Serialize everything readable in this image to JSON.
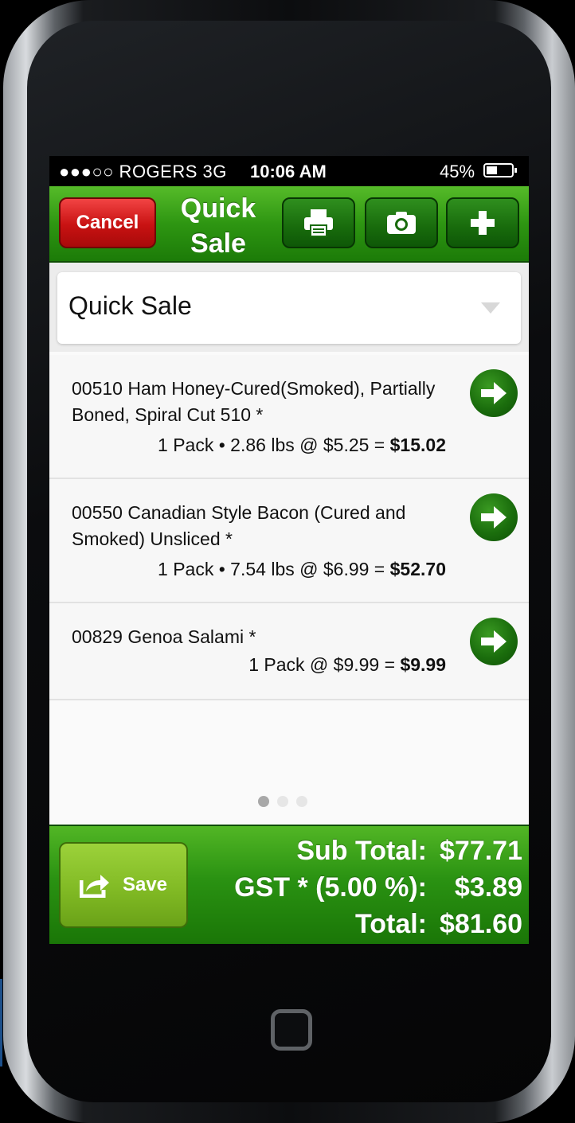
{
  "status_bar": {
    "carrier": "●●●○○ ROGERS  3G",
    "time": "10:06 AM",
    "battery": "45%",
    "battery_level": 0.45
  },
  "nav": {
    "cancel_label": "Cancel",
    "title_line1": "Quick",
    "title_line2": "Sale",
    "print_icon": "printer-icon",
    "camera_icon": "camera-icon",
    "add_icon": "plus-icon"
  },
  "selector": {
    "value": "Quick Sale"
  },
  "items": [
    {
      "line1": "00510 Ham Honey-Cured(Smoked), Partially",
      "line2": "Boned, Spiral Cut 510 *",
      "calc": "1 Pack • 2.86 lbs @ $5.25 = ",
      "total": "$15.02"
    },
    {
      "line1": "00550 Canadian Style Bacon (Cured and",
      "line2": "Smoked) Unsliced  *",
      "calc": "1 Pack • 7.54 lbs @ $6.99 = ",
      "total": "$52.70"
    },
    {
      "line1": "00829 Genoa Salami  *",
      "line2": "",
      "calc": "1 Pack @ $9.99 = ",
      "total": "$9.99"
    }
  ],
  "pager": {
    "pages": 3,
    "current": 1
  },
  "footer": {
    "save_label": "Save",
    "subtotal_label": "Sub Total:",
    "subtotal_value": "$77.71",
    "gst_label": "GST * (5.00 %):",
    "gst_value": "$3.89",
    "total_label": "Total:",
    "total_value": "$81.60"
  },
  "colors": {
    "nav_green": "#2e9612",
    "cancel_red": "#c81212",
    "save_green": "#7fb823",
    "arrow_green": "#1b6e0d"
  }
}
